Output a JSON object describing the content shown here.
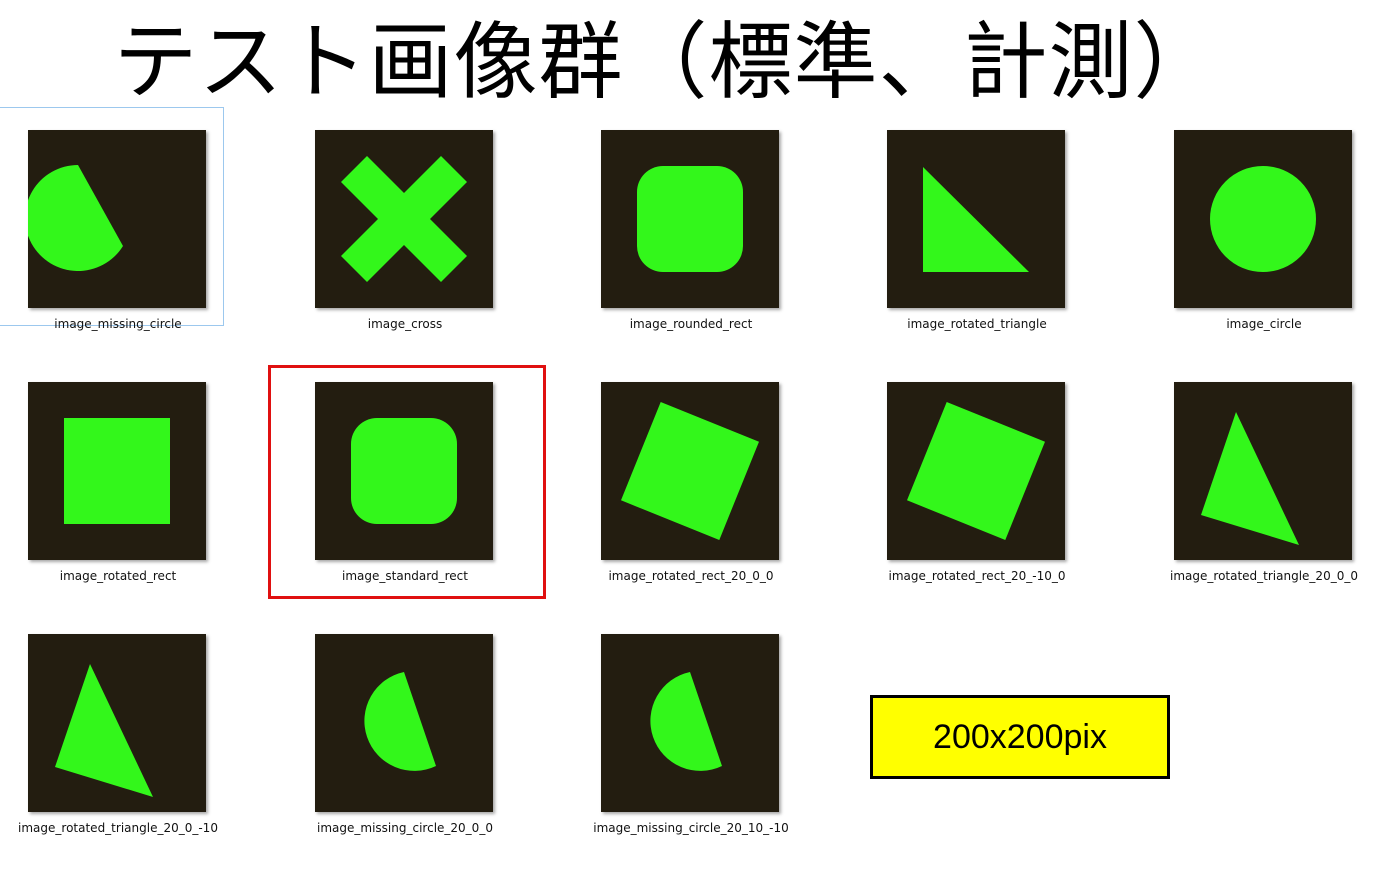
{
  "title": "テスト画像群（標準、計測）",
  "colors": {
    "thumb_bg": "#231d10",
    "shape": "#33f71b",
    "highlight": "#e01010",
    "note_bg": "#ffff00"
  },
  "files": [
    {
      "name": "image_missing_circle",
      "shape": "missing_circle",
      "focused": true
    },
    {
      "name": "image_cross",
      "shape": "cross"
    },
    {
      "name": "image_rounded_rect",
      "shape": "rounded_rect"
    },
    {
      "name": "image_rotated_triangle",
      "shape": "right_triangle"
    },
    {
      "name": "image_circle",
      "shape": "circle"
    },
    {
      "name": "image_rotated_rect",
      "shape": "square"
    },
    {
      "name": "image_standard_rect",
      "shape": "rounded_rect",
      "highlighted": true
    },
    {
      "name": "image_rotated_rect_20_0_0",
      "shape": "rotated_square"
    },
    {
      "name": "image_rotated_rect_20_-10_0",
      "shape": "rotated_square"
    },
    {
      "name": "image_rotated_triangle_20_0_0",
      "shape": "rotated_triangle"
    },
    {
      "name": "image_rotated_triangle_20_0_-10",
      "shape": "rotated_triangle"
    },
    {
      "name": "image_missing_circle_20_0_0",
      "shape": "rotated_half_circle"
    },
    {
      "name": "image_missing_circle_20_10_-10",
      "shape": "rotated_half_circle"
    }
  ],
  "size_note": "200x200pix"
}
